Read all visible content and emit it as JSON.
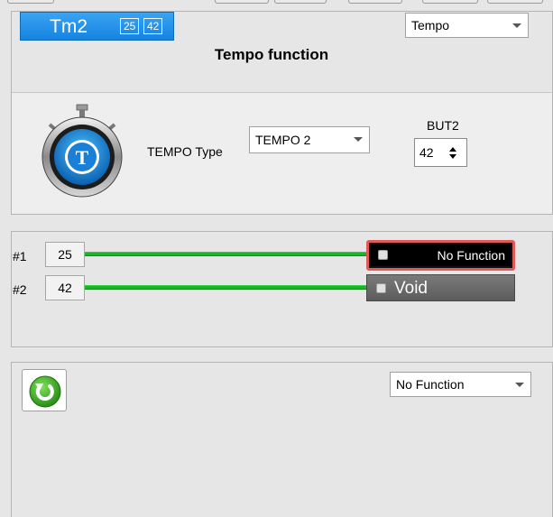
{
  "header": {
    "tm_label": "Tm2",
    "tm_value1": "25",
    "tm_value2": "42",
    "mode_dropdown": "Tempo",
    "title": "Tempo function"
  },
  "tempo": {
    "type_label": "TEMPO Type",
    "type_value": "TEMPO 2",
    "but_label": "BUT2",
    "but_value": "42"
  },
  "connections": [
    {
      "label": "#1",
      "value": "25",
      "function": "No Function"
    },
    {
      "label": "#2",
      "value": "42",
      "function": "Void"
    }
  ],
  "bottom": {
    "dropdown": "No Function"
  },
  "colors": {
    "accent_blue": "#1583e0",
    "line_green": "#1bb52a",
    "highlight_red": "#e05a5a",
    "refresh_green": "#3eae27"
  }
}
